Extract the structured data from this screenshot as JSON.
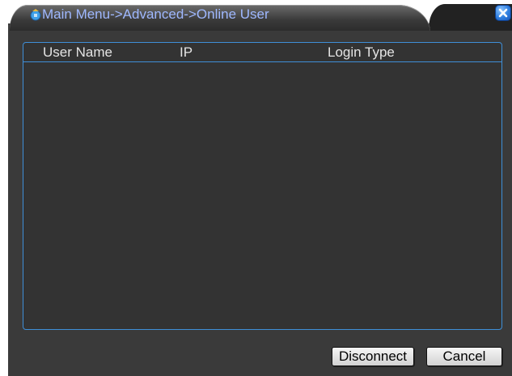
{
  "window": {
    "title": "Main Menu->Advanced->Online User"
  },
  "icons": {
    "app": "app-menu-icon",
    "close": "close-icon"
  },
  "table": {
    "columns": [
      "User Name",
      "IP",
      "Login Type"
    ],
    "rows": []
  },
  "buttons": {
    "disconnect_label": "Disconnect",
    "cancel_label": "Cancel"
  },
  "colors": {
    "accent_border": "#3f8fd8",
    "title_text": "#9fb8ff",
    "background": "#3a3a3a"
  }
}
